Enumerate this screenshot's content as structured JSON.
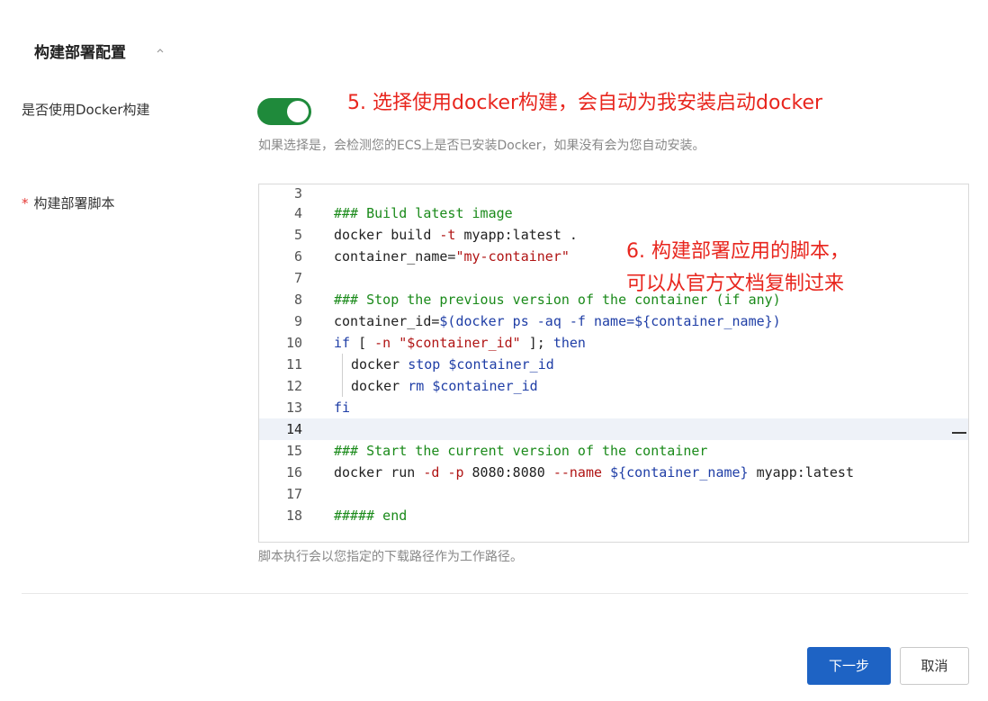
{
  "section": {
    "title": "构建部署配置"
  },
  "docker_option": {
    "label": "是否使用Docker构建",
    "enabled": true,
    "hint": "如果选择是，会检测您的ECS上是否已安装Docker，如果没有会为您自动安装。"
  },
  "annotations": {
    "a5": "5. 选择使用docker构建，会自动为我安装启动docker",
    "a6_line1": "6. 构建部署应用的脚本，",
    "a6_line2": "可以从官方文档复制过来"
  },
  "script": {
    "required_mark": "*",
    "label": "构建部署脚本",
    "hint": "脚本执行会以您指定的下载路径作为工作路径。",
    "current_line": "14",
    "lines": [
      {
        "n": "3",
        "tokens": []
      },
      {
        "n": "4",
        "tokens": [
          {
            "t": "### Build latest image",
            "c": "comment"
          }
        ]
      },
      {
        "n": "5",
        "tokens": [
          {
            "t": "docker build ",
            "c": ""
          },
          {
            "t": "-t",
            "c": "flag"
          },
          {
            "t": " myapp:latest .",
            "c": ""
          }
        ]
      },
      {
        "n": "6",
        "tokens": [
          {
            "t": "container_name=",
            "c": ""
          },
          {
            "t": "\"my-container\"",
            "c": "str"
          }
        ]
      },
      {
        "n": "7",
        "tokens": []
      },
      {
        "n": "8",
        "tokens": [
          {
            "t": "### Stop the previous version of the container (if any)",
            "c": "comment"
          }
        ]
      },
      {
        "n": "9",
        "tokens": [
          {
            "t": "container_id=",
            "c": ""
          },
          {
            "t": "$(docker ps -aq -f name=${container_name})",
            "c": "key"
          }
        ]
      },
      {
        "n": "10",
        "tokens": [
          {
            "t": "if",
            "c": "key"
          },
          {
            "t": " [ ",
            "c": ""
          },
          {
            "t": "-n",
            "c": "flag"
          },
          {
            "t": " ",
            "c": ""
          },
          {
            "t": "\"$container_id\"",
            "c": "str"
          },
          {
            "t": " ]; ",
            "c": ""
          },
          {
            "t": "then",
            "c": "key"
          }
        ]
      },
      {
        "n": "11",
        "indent": true,
        "tokens": [
          {
            "t": "docker ",
            "c": ""
          },
          {
            "t": "stop",
            "c": "key"
          },
          {
            "t": " ",
            "c": ""
          },
          {
            "t": "$container_id",
            "c": "key"
          }
        ]
      },
      {
        "n": "12",
        "indent": true,
        "tokens": [
          {
            "t": "docker ",
            "c": ""
          },
          {
            "t": "rm",
            "c": "key"
          },
          {
            "t": " ",
            "c": ""
          },
          {
            "t": "$container_id",
            "c": "key"
          }
        ]
      },
      {
        "n": "13",
        "tokens": [
          {
            "t": "fi",
            "c": "key"
          }
        ]
      },
      {
        "n": "14",
        "tokens": []
      },
      {
        "n": "15",
        "tokens": [
          {
            "t": "### Start the current version of the container",
            "c": "comment"
          }
        ]
      },
      {
        "n": "16",
        "tokens": [
          {
            "t": "docker run ",
            "c": ""
          },
          {
            "t": "-d",
            "c": "flag"
          },
          {
            "t": " ",
            "c": ""
          },
          {
            "t": "-p",
            "c": "flag"
          },
          {
            "t": " 8080:8080 ",
            "c": ""
          },
          {
            "t": "--name",
            "c": "flag"
          },
          {
            "t": " ",
            "c": ""
          },
          {
            "t": "${container_name}",
            "c": "key"
          },
          {
            "t": " myapp:latest",
            "c": ""
          }
        ]
      },
      {
        "n": "17",
        "tokens": []
      },
      {
        "n": "18",
        "tokens": [
          {
            "t": "##### end",
            "c": "comment"
          }
        ]
      }
    ]
  },
  "actions": {
    "next_label": "下一步",
    "cancel_label": "取消"
  }
}
